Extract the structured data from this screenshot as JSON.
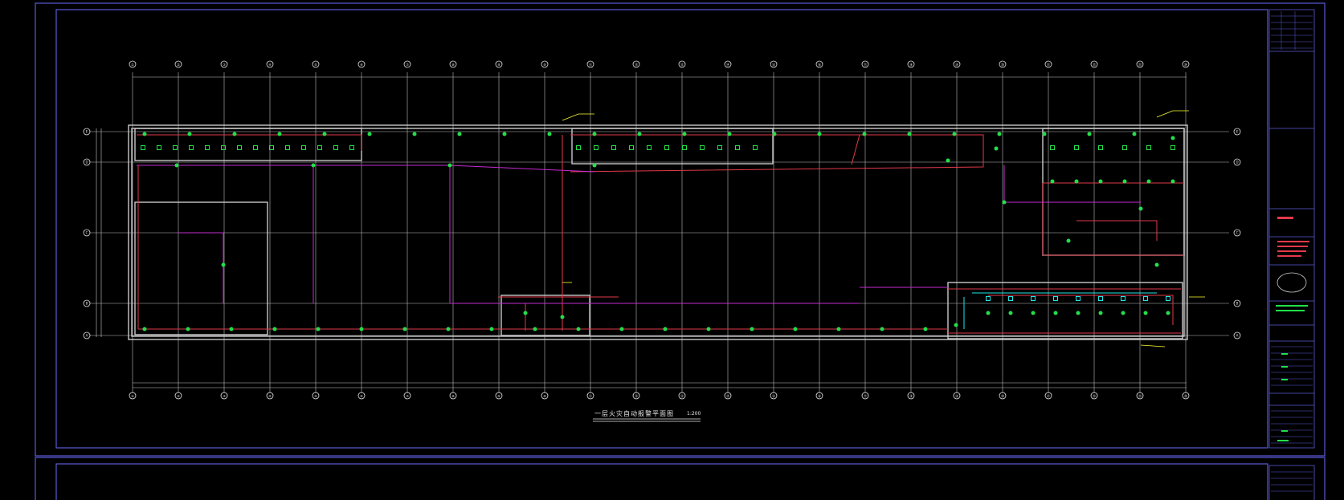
{
  "drawing": {
    "title": "一层火灾自动报警平面图",
    "scale": "1:200",
    "axis_top": [
      "①",
      "②",
      "③",
      "④",
      "⑤",
      "⑥",
      "⑦",
      "⑧",
      "⑨",
      "⑩",
      "⑪",
      "⑫",
      "⑬",
      "⑭",
      "⑮",
      "⑯",
      "⑰",
      "⑱",
      "⑲",
      "⑳",
      "㉑",
      "㉒",
      "㉓",
      "㉔"
    ],
    "axis_side": [
      "E",
      "D",
      "C",
      "B",
      "A"
    ]
  },
  "colors": {
    "frame": "#5a5ad8",
    "wall": "#c9c9c9",
    "grid": "#e6e6e6",
    "wire_red": "#e23a4a",
    "wire_magenta": "#c42bd0",
    "device": "#22e04a",
    "device_cyan": "#22e6e6",
    "note": "#ffff33"
  }
}
